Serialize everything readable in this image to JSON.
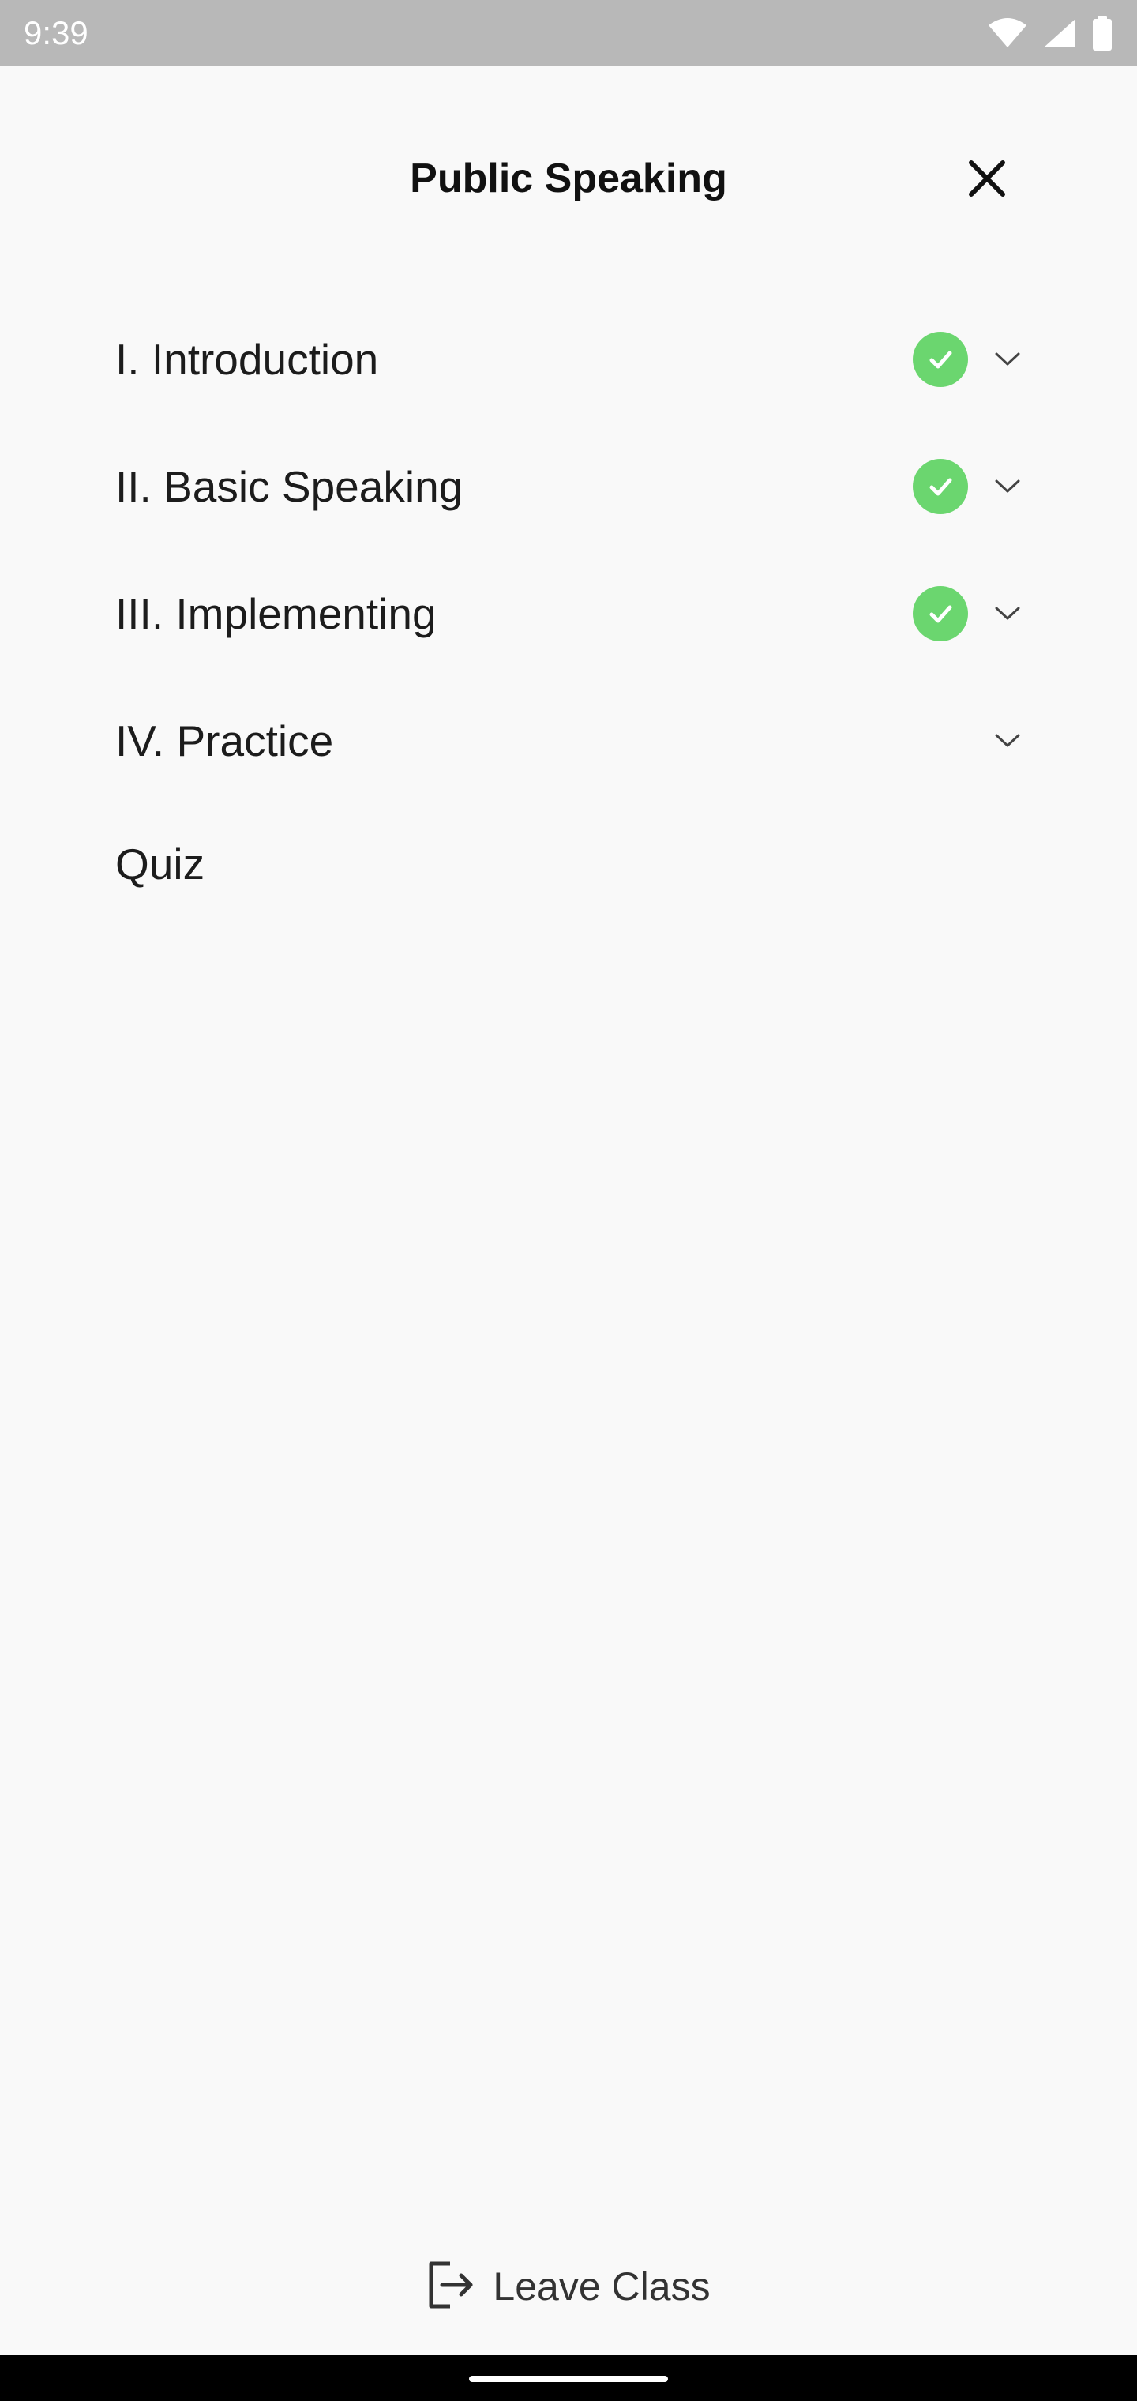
{
  "status_bar": {
    "time": "9:39",
    "icons": [
      "wifi-icon",
      "cellular-signal-icon",
      "battery-icon"
    ]
  },
  "header": {
    "title": "Public Speaking",
    "close_icon": "close-icon"
  },
  "lessons": [
    {
      "label": "I. Introduction",
      "completed": true,
      "expandable": true
    },
    {
      "label": "II. Basic Speaking",
      "completed": true,
      "expandable": true
    },
    {
      "label": "III. Implementing",
      "completed": true,
      "expandable": true
    },
    {
      "label": "IV. Practice",
      "completed": false,
      "expandable": true
    },
    {
      "label": "Quiz",
      "completed": false,
      "expandable": false
    }
  ],
  "footer": {
    "leave_label": "Leave Class",
    "leave_icon": "exit-icon"
  },
  "colors": {
    "status_bar_bg": "#b8b8b8",
    "background": "#f9f9f9",
    "check_green": "#6bd66f",
    "nav_bar_bg": "#000000"
  }
}
